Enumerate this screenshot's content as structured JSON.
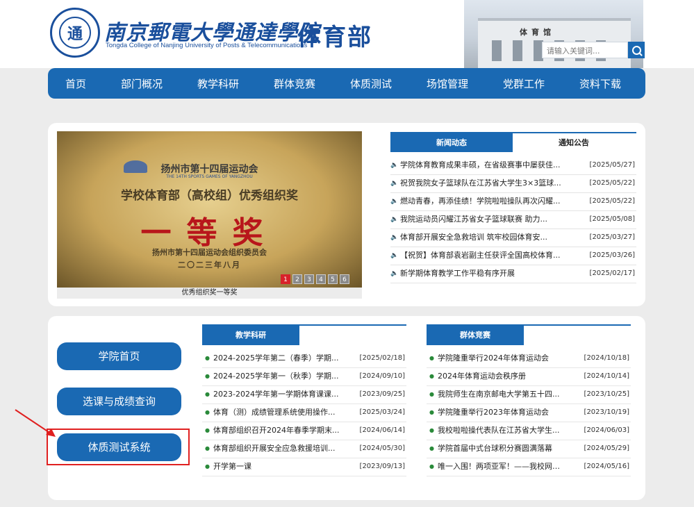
{
  "header": {
    "logo_glyph": "通",
    "school_name": "南京郵電大學通達學院",
    "school_en": "Tongda College of Nanjing University of Posts & Telecommunications",
    "dept": "体育部",
    "building_sign": "体育馆"
  },
  "search": {
    "placeholder": "请输入关键词..."
  },
  "nav": [
    "首页",
    "部门概况",
    "教学科研",
    "群体竞赛",
    "体质测试",
    "场馆管理",
    "党群工作",
    "资料下载"
  ],
  "slider": {
    "plaque_title": "扬州市第十四届运动会",
    "plaque_en": "THE 14TH SPORTS GAMES OF YANGZHOU",
    "plaque_award": "学校体育部（高校组）优秀组织奖",
    "plaque_grade": "一等奖",
    "plaque_org": "扬州市第十四届运动会组织委员会",
    "plaque_date": "二〇二三年八月",
    "caption": "优秀组织奖一等奖",
    "pages": [
      "1",
      "2",
      "3",
      "4",
      "5",
      "6"
    ],
    "active_page": 1
  },
  "news_tabs": [
    "新闻动态",
    "通知公告"
  ],
  "news": [
    {
      "title": "学院体育教育成果丰硕，在省级赛事中屡获佳...",
      "date": "[2025/05/27]"
    },
    {
      "title": "祝贺我院女子篮球队在江苏省大学生3×3篮球...",
      "date": "[2025/05/22]"
    },
    {
      "title": "燃动青春，再添佳绩！学院啦啦操队再次闪耀...",
      "date": "[2025/05/22]"
    },
    {
      "title": "我院运动员闪耀江苏省女子篮球联赛 助力...",
      "date": "[2025/05/08]"
    },
    {
      "title": "体育部开展安全急救培训 筑牢校园体育安...",
      "date": "[2025/03/27]"
    },
    {
      "title": "【祝贺】体育部袁岩副主任获评全国高校体育...",
      "date": "[2025/03/26]"
    },
    {
      "title": "新学期体育教学工作平稳有序开展",
      "date": "[2025/02/17]"
    }
  ],
  "quick_links": [
    "学院首页",
    "选课与成绩查询",
    "体质测试系统"
  ],
  "teaching": {
    "header": "教学科研",
    "items": [
      {
        "title": "2024-2025学年第二（春季）学期...",
        "date": "[2025/02/18]"
      },
      {
        "title": "2024-2025学年第一（秋季）学期...",
        "date": "[2024/09/10]"
      },
      {
        "title": "2023-2024学年第一学期体育课课...",
        "date": "[2023/09/25]"
      },
      {
        "title": "体育（测）成绩管理系统使用操作...",
        "date": "[2025/03/24]"
      },
      {
        "title": "体育部组织召开2024年春季学期末...",
        "date": "[2024/06/14]"
      },
      {
        "title": "体育部组织开展安全应急救援培训...",
        "date": "[2024/05/30]"
      },
      {
        "title": "开学第一课",
        "date": "[2023/09/13]"
      }
    ]
  },
  "competition": {
    "header": "群体竞赛",
    "items": [
      {
        "title": "学院隆重举行2024年体育运动会",
        "date": "[2024/10/18]"
      },
      {
        "title": "2024年体育运动会秩序册",
        "date": "[2024/10/14]"
      },
      {
        "title": "我院师生在南京邮电大学第五十四...",
        "date": "[2023/10/25]"
      },
      {
        "title": "学院隆重举行2023年体育运动会",
        "date": "[2023/10/19]"
      },
      {
        "title": "我校啦啦操代表队在江苏省大学生...",
        "date": "[2024/06/03]"
      },
      {
        "title": "学院首届中式台球积分赛圆满落幕",
        "date": "[2024/05/29]"
      },
      {
        "title": "唯一入围！两项亚军！——我校网球...",
        "date": "[2024/05/16]"
      }
    ]
  },
  "colors": {
    "primary": "#1a69b3",
    "highlight": "#e02020",
    "active_dot": "#d8222a"
  }
}
